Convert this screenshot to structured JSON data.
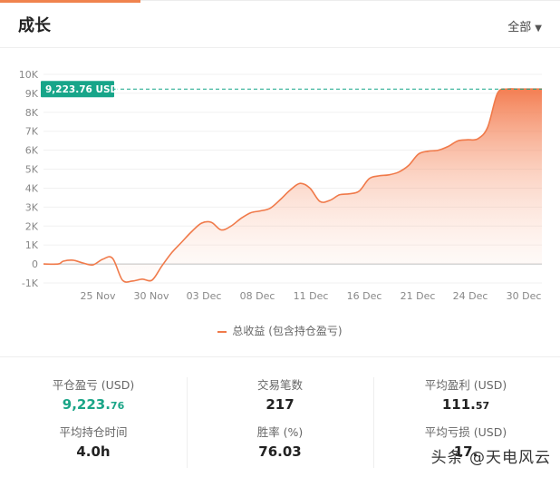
{
  "header": {
    "title": "成长",
    "range_label": "全部"
  },
  "chart_data": {
    "type": "area",
    "x_tick_labels": [
      "25 Nov",
      "30 Nov",
      "03 Dec",
      "08 Dec",
      "11 Dec",
      "16 Dec",
      "21 Dec",
      "24 Dec",
      "30 Dec"
    ],
    "y_tick_labels": [
      "-1K",
      "0",
      "1K",
      "2K",
      "3K",
      "4K",
      "5K",
      "6K",
      "7K",
      "8K",
      "9K",
      "10K"
    ],
    "ylim": [
      -1000,
      10000
    ],
    "grid": true,
    "legend_position": "bottom",
    "series": [
      {
        "name": "总收益 (包含持仓盈亏)",
        "x": [
          0,
          1.5,
          2,
          3,
          4,
          5,
          6,
          7,
          8,
          9,
          10,
          11,
          12,
          13,
          14,
          15,
          16,
          17,
          18,
          19,
          20,
          21,
          22,
          23,
          24,
          25,
          26,
          27,
          28,
          29,
          30,
          31,
          32,
          33,
          34,
          35,
          36,
          37,
          38,
          39,
          40,
          41,
          42,
          43,
          44,
          45,
          46,
          47,
          48,
          49,
          50,
          50.5
        ],
        "values": [
          0,
          0,
          150,
          200,
          50,
          -50,
          250,
          300,
          -850,
          -900,
          -800,
          -850,
          -100,
          600,
          1150,
          1700,
          2150,
          2200,
          1800,
          2000,
          2400,
          2700,
          2800,
          2950,
          3400,
          3900,
          4250,
          4000,
          3300,
          3350,
          3650,
          3700,
          3850,
          4500,
          4650,
          4700,
          4850,
          5200,
          5800,
          5950,
          6000,
          6200,
          6500,
          6550,
          6600,
          7200,
          9000,
          9223.76,
          9223.76,
          9223.76,
          9223.76,
          9223.76
        ]
      }
    ],
    "marker": {
      "value": 9223.76,
      "label": "9,223.76 USD"
    }
  },
  "stats": [
    {
      "label": "平仓盈亏 (USD)",
      "value_main": "9,223.",
      "value_dec": "76"
    },
    {
      "label": "交易笔数",
      "value": "217"
    },
    {
      "label": "平均盈利 (USD)",
      "value_main": "111.",
      "value_dec": "57"
    },
    {
      "label": "平均持仓时间",
      "value": "4.0h"
    },
    {
      "label": "胜率 (%)",
      "value": "76.03"
    },
    {
      "label": "平均亏损 (USD)",
      "value": "17."
    }
  ],
  "watermark": "头条 @天电风云",
  "colors": {
    "accent": "#f0834e",
    "line": "#f07a4a",
    "positive": "#1aa587",
    "marker_bg": "#17a589"
  }
}
